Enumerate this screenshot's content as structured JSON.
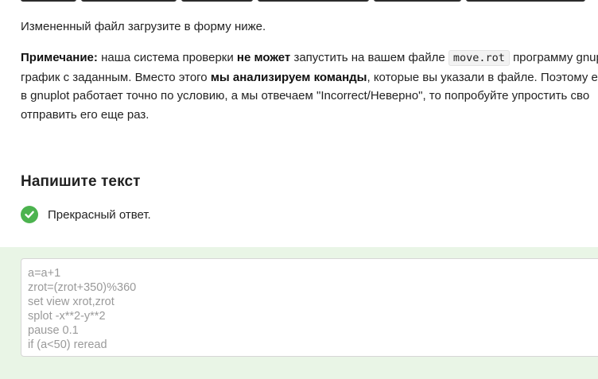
{
  "upload_instruction": "Измененный файл загрузите в форму ниже.",
  "note": {
    "label": "Примечание:",
    "line1_a": "наша система проверки",
    "line1_b": "не может",
    "line1_c": "запустить на вашем файле",
    "filename": "move.rot",
    "line1_d": "программу gnup",
    "line2_a": "график с заданным. Вместо этого",
    "line2_b": "мы анализируем команды",
    "line2_c": ", которые вы указали в файле. Поэтому ес",
    "line3": "в gnuplot работает точно по условию, а мы отвечаем \"Incorrect/Неверно\", то попробуйте упростить сво",
    "line4": "отправить его еще раз."
  },
  "answer_section": {
    "title": "Напишите текст",
    "feedback_text": "Прекрасный ответ.",
    "feedback_status_color": "#4cb34f",
    "answer_text": "a=a+1\nzrot=(zrot+350)%360\nset view xrot,zrot\nsplot -x**2-y**2\npause 0.1\nif (a<50) reread"
  }
}
